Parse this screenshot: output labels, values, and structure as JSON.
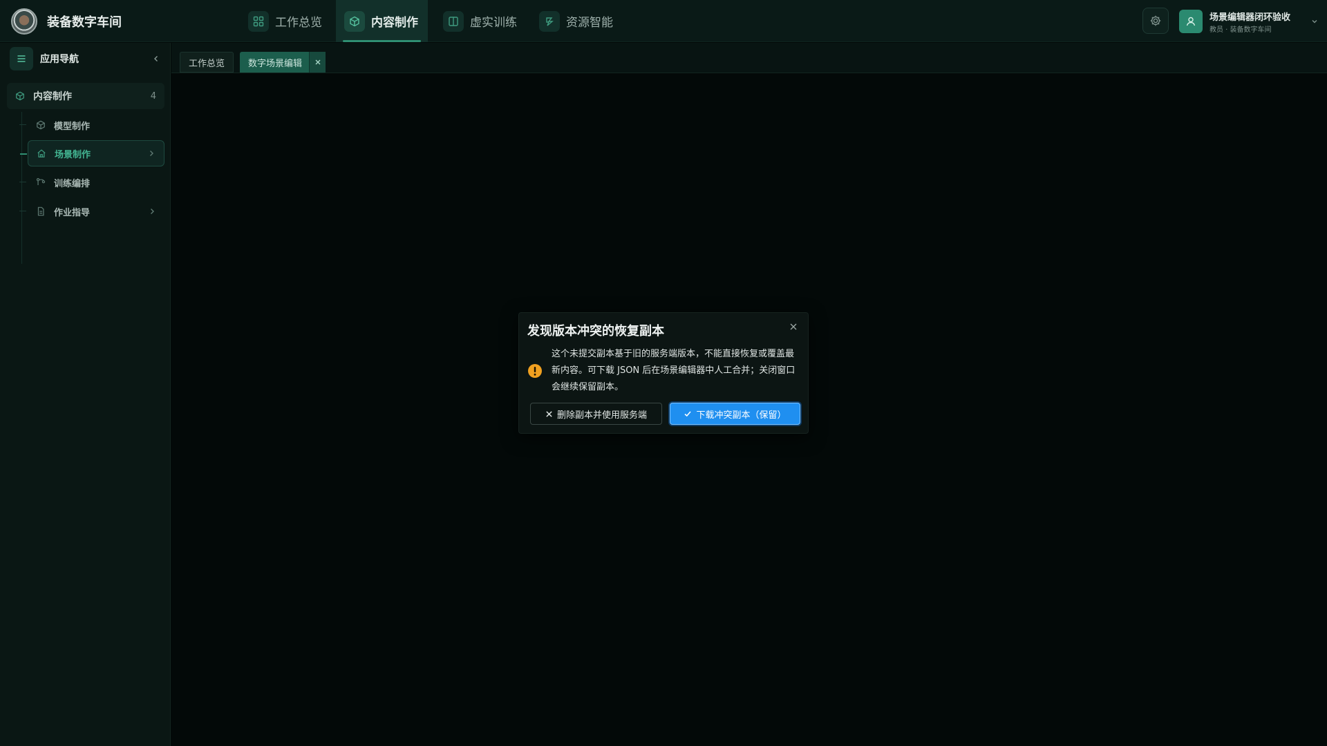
{
  "app": {
    "title": "装备数字车间"
  },
  "topnav": {
    "items": [
      {
        "label": "工作总览",
        "icon": "grid-icon",
        "active": false
      },
      {
        "label": "内容制作",
        "icon": "cube-icon",
        "active": true
      },
      {
        "label": "虚实训练",
        "icon": "book-icon",
        "active": false
      },
      {
        "label": "资源智能",
        "icon": "spark-icon",
        "active": false
      }
    ]
  },
  "user": {
    "name": "场景编辑器闭环验收",
    "role": "教员 · 装备数字车间"
  },
  "sidebar": {
    "title": "应用导航",
    "group": {
      "label": "内容制作",
      "count": "4"
    },
    "items": [
      {
        "label": "模型制作",
        "icon": "cube-icon"
      },
      {
        "label": "场景制作",
        "icon": "home-icon",
        "active": true
      },
      {
        "label": "训练编排",
        "icon": "flow-icon"
      },
      {
        "label": "作业指导",
        "icon": "document-icon"
      }
    ]
  },
  "tabs": [
    {
      "label": "工作总览"
    },
    {
      "label": "数字场景编辑",
      "active": true
    }
  ],
  "dialog": {
    "title": "发现版本冲突的恢复副本",
    "message": "这个未提交副本基于旧的服务端版本，不能直接恢复或覆盖最新内容。可下载 JSON 后在场景编辑器中人工合并；关闭窗口会继续保留副本。",
    "secondary_label": "删除副本并使用服务端",
    "primary_label": "下载冲突副本（保留）"
  },
  "colors": {
    "accent": "#2f8f72",
    "primary_button": "#1f8ff0",
    "warning": "#f0a020",
    "background": "#030908"
  }
}
